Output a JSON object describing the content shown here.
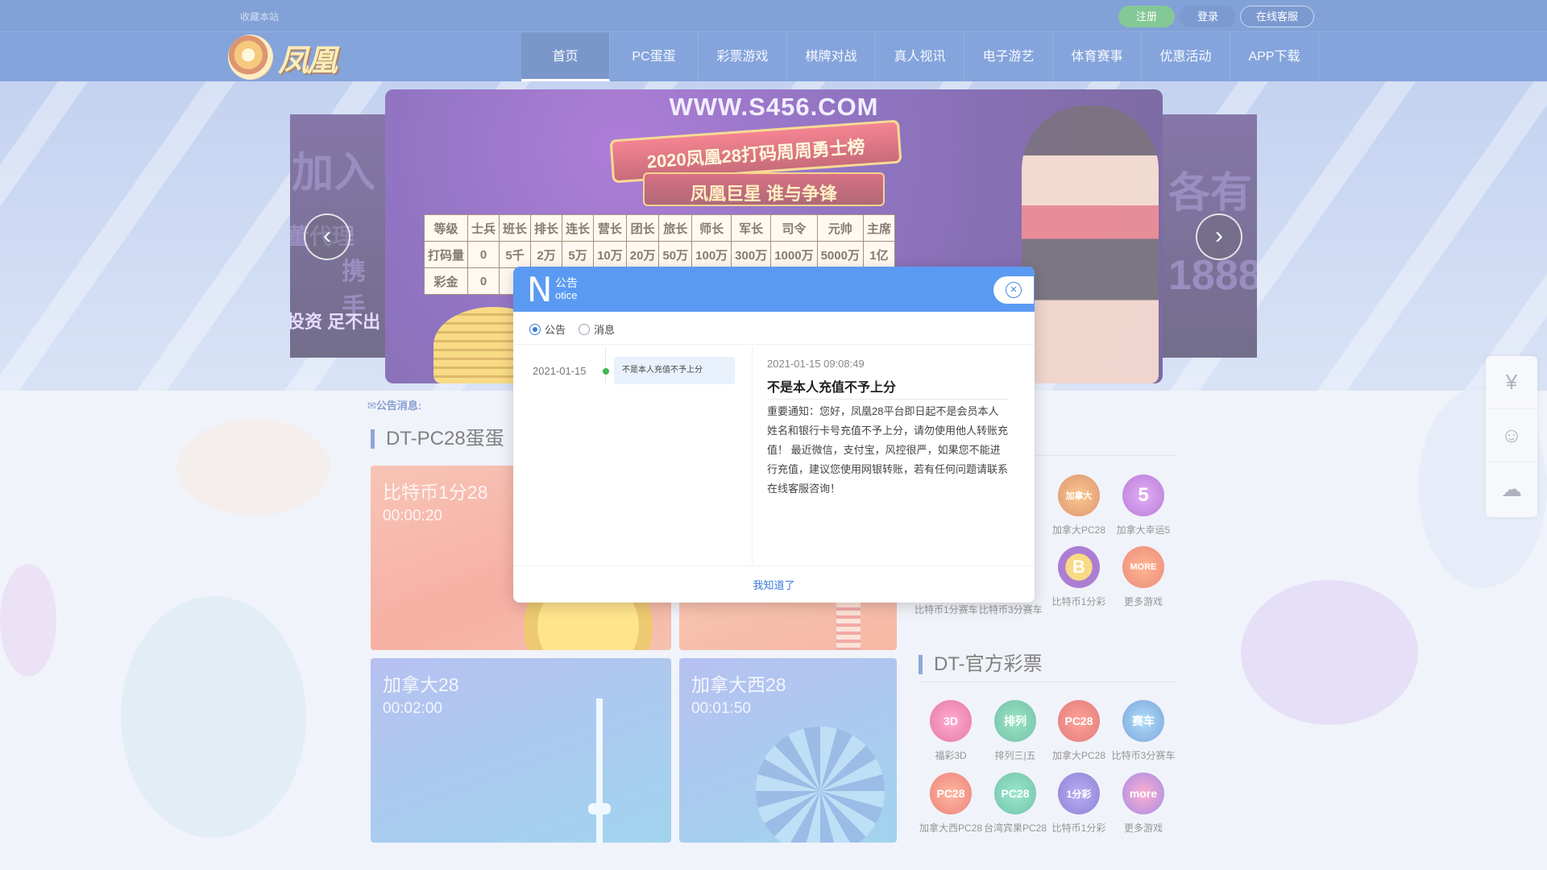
{
  "header": {
    "favorite": "收藏本站",
    "register": "注册",
    "login": "登录",
    "online_service": "在线客服",
    "logo_text": "凤凰"
  },
  "nav": [
    "首页",
    "PC蛋蛋",
    "彩票游戏",
    "棋牌对战",
    "真人视讯",
    "电子游艺",
    "体育赛事",
    "优惠活动",
    "APP下载"
  ],
  "banner": {
    "url": "WWW.S456.COM",
    "ribbon_title": "2020凤凰28打码周周勇士榜",
    "ribbon_subtitle": "凤凰巨星 谁与争锋",
    "table": {
      "header": [
        "等级",
        "士兵",
        "班长",
        "排长",
        "连长",
        "营长",
        "团长",
        "旅长",
        "师长",
        "军长",
        "司令",
        "元帅",
        "主席"
      ],
      "row1": [
        "打码量",
        "0",
        "5千",
        "2万",
        "5万",
        "10万",
        "20万",
        "50万",
        "100万",
        "300万",
        "1000万",
        "5000万",
        "1亿"
      ],
      "row2": [
        "彩金",
        "0"
      ]
    },
    "left_peek": [
      "加入",
      "董代理",
      "携手",
      "投资 足不出"
    ],
    "right_peek": [
      "各有",
      "1888"
    ]
  },
  "notice_label": "公告消息:",
  "sections": {
    "pc28_title": "DT-PC28蛋蛋",
    "official_title": "DT-官方彩票"
  },
  "cards": [
    {
      "title": "比特币1分28",
      "time": "00:00:20"
    },
    {
      "title": "加拿大28",
      "time": "00:02:00"
    },
    {
      "title": "加拿大西28",
      "time": "00:01:50"
    }
  ],
  "hot_games": [
    {
      "label": "加拿大PC28",
      "icon": "加拿大"
    },
    {
      "label": "加拿大幸运5",
      "icon": "5"
    },
    {
      "label": "比特币1分彩",
      "icon": "B"
    },
    {
      "label": "更多游戏",
      "icon": "MORE"
    }
  ],
  "hot_partial_labels": [
    "比特币1分赛车",
    "比特币3分赛车"
  ],
  "official_games": [
    {
      "label": "福彩3D",
      "icon": "3D"
    },
    {
      "label": "排列三|五",
      "icon": "排列"
    },
    {
      "label": "加拿大PC28",
      "icon": "PC28"
    },
    {
      "label": "比特币3分赛车",
      "icon": "赛车"
    },
    {
      "label": "加拿大西PC28",
      "icon": "PC28"
    },
    {
      "label": "台湾宾果PC28",
      "icon": "PC28"
    },
    {
      "label": "比特币1分彩",
      "icon": "1分彩"
    },
    {
      "label": "更多游戏",
      "icon": "more"
    }
  ],
  "modal": {
    "head_letter": "N",
    "head_cn": "公告",
    "head_en": "otice",
    "tabs": [
      {
        "label": "公告",
        "selected": true
      },
      {
        "label": "消息",
        "selected": false
      }
    ],
    "list": [
      {
        "date": "2021-01-15",
        "title": "不是本人充值不予上分"
      }
    ],
    "detail": {
      "time": "2021-01-15 09:08:49",
      "title": "不是本人充值不予上分",
      "body": "重要通知：您好，凤凰28平台即日起不是会员本人姓名和银行卡号充值不予上分，请勿使用他人转账充值！ 最近微信，支付宝，风控很严，如果您不能进行充值，建议您使用网银转账，若有任何问题请联系在线客服咨询！"
    },
    "ok": "我知道了"
  },
  "colors": {
    "nav_bg": "#3a6dc6",
    "modal_head": "#5a9af2",
    "register_green": "#3aa657",
    "link_blue": "#3a7bd8"
  }
}
